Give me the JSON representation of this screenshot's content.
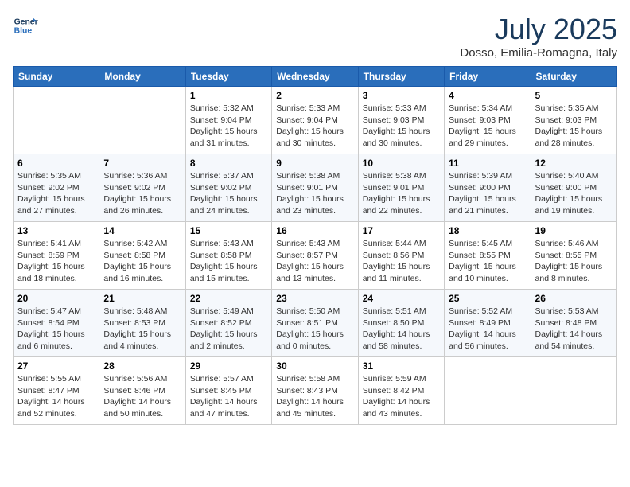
{
  "header": {
    "logo_line1": "General",
    "logo_line2": "Blue",
    "month": "July 2025",
    "location": "Dosso, Emilia-Romagna, Italy"
  },
  "days_of_week": [
    "Sunday",
    "Monday",
    "Tuesday",
    "Wednesday",
    "Thursday",
    "Friday",
    "Saturday"
  ],
  "weeks": [
    [
      {
        "day": "",
        "info": ""
      },
      {
        "day": "",
        "info": ""
      },
      {
        "day": "1",
        "info": "Sunrise: 5:32 AM\nSunset: 9:04 PM\nDaylight: 15 hours and 31 minutes."
      },
      {
        "day": "2",
        "info": "Sunrise: 5:33 AM\nSunset: 9:04 PM\nDaylight: 15 hours and 30 minutes."
      },
      {
        "day": "3",
        "info": "Sunrise: 5:33 AM\nSunset: 9:03 PM\nDaylight: 15 hours and 30 minutes."
      },
      {
        "day": "4",
        "info": "Sunrise: 5:34 AM\nSunset: 9:03 PM\nDaylight: 15 hours and 29 minutes."
      },
      {
        "day": "5",
        "info": "Sunrise: 5:35 AM\nSunset: 9:03 PM\nDaylight: 15 hours and 28 minutes."
      }
    ],
    [
      {
        "day": "6",
        "info": "Sunrise: 5:35 AM\nSunset: 9:02 PM\nDaylight: 15 hours and 27 minutes."
      },
      {
        "day": "7",
        "info": "Sunrise: 5:36 AM\nSunset: 9:02 PM\nDaylight: 15 hours and 26 minutes."
      },
      {
        "day": "8",
        "info": "Sunrise: 5:37 AM\nSunset: 9:02 PM\nDaylight: 15 hours and 24 minutes."
      },
      {
        "day": "9",
        "info": "Sunrise: 5:38 AM\nSunset: 9:01 PM\nDaylight: 15 hours and 23 minutes."
      },
      {
        "day": "10",
        "info": "Sunrise: 5:38 AM\nSunset: 9:01 PM\nDaylight: 15 hours and 22 minutes."
      },
      {
        "day": "11",
        "info": "Sunrise: 5:39 AM\nSunset: 9:00 PM\nDaylight: 15 hours and 21 minutes."
      },
      {
        "day": "12",
        "info": "Sunrise: 5:40 AM\nSunset: 9:00 PM\nDaylight: 15 hours and 19 minutes."
      }
    ],
    [
      {
        "day": "13",
        "info": "Sunrise: 5:41 AM\nSunset: 8:59 PM\nDaylight: 15 hours and 18 minutes."
      },
      {
        "day": "14",
        "info": "Sunrise: 5:42 AM\nSunset: 8:58 PM\nDaylight: 15 hours and 16 minutes."
      },
      {
        "day": "15",
        "info": "Sunrise: 5:43 AM\nSunset: 8:58 PM\nDaylight: 15 hours and 15 minutes."
      },
      {
        "day": "16",
        "info": "Sunrise: 5:43 AM\nSunset: 8:57 PM\nDaylight: 15 hours and 13 minutes."
      },
      {
        "day": "17",
        "info": "Sunrise: 5:44 AM\nSunset: 8:56 PM\nDaylight: 15 hours and 11 minutes."
      },
      {
        "day": "18",
        "info": "Sunrise: 5:45 AM\nSunset: 8:55 PM\nDaylight: 15 hours and 10 minutes."
      },
      {
        "day": "19",
        "info": "Sunrise: 5:46 AM\nSunset: 8:55 PM\nDaylight: 15 hours and 8 minutes."
      }
    ],
    [
      {
        "day": "20",
        "info": "Sunrise: 5:47 AM\nSunset: 8:54 PM\nDaylight: 15 hours and 6 minutes."
      },
      {
        "day": "21",
        "info": "Sunrise: 5:48 AM\nSunset: 8:53 PM\nDaylight: 15 hours and 4 minutes."
      },
      {
        "day": "22",
        "info": "Sunrise: 5:49 AM\nSunset: 8:52 PM\nDaylight: 15 hours and 2 minutes."
      },
      {
        "day": "23",
        "info": "Sunrise: 5:50 AM\nSunset: 8:51 PM\nDaylight: 15 hours and 0 minutes."
      },
      {
        "day": "24",
        "info": "Sunrise: 5:51 AM\nSunset: 8:50 PM\nDaylight: 14 hours and 58 minutes."
      },
      {
        "day": "25",
        "info": "Sunrise: 5:52 AM\nSunset: 8:49 PM\nDaylight: 14 hours and 56 minutes."
      },
      {
        "day": "26",
        "info": "Sunrise: 5:53 AM\nSunset: 8:48 PM\nDaylight: 14 hours and 54 minutes."
      }
    ],
    [
      {
        "day": "27",
        "info": "Sunrise: 5:55 AM\nSunset: 8:47 PM\nDaylight: 14 hours and 52 minutes."
      },
      {
        "day": "28",
        "info": "Sunrise: 5:56 AM\nSunset: 8:46 PM\nDaylight: 14 hours and 50 minutes."
      },
      {
        "day": "29",
        "info": "Sunrise: 5:57 AM\nSunset: 8:45 PM\nDaylight: 14 hours and 47 minutes."
      },
      {
        "day": "30",
        "info": "Sunrise: 5:58 AM\nSunset: 8:43 PM\nDaylight: 14 hours and 45 minutes."
      },
      {
        "day": "31",
        "info": "Sunrise: 5:59 AM\nSunset: 8:42 PM\nDaylight: 14 hours and 43 minutes."
      },
      {
        "day": "",
        "info": ""
      },
      {
        "day": "",
        "info": ""
      }
    ]
  ]
}
